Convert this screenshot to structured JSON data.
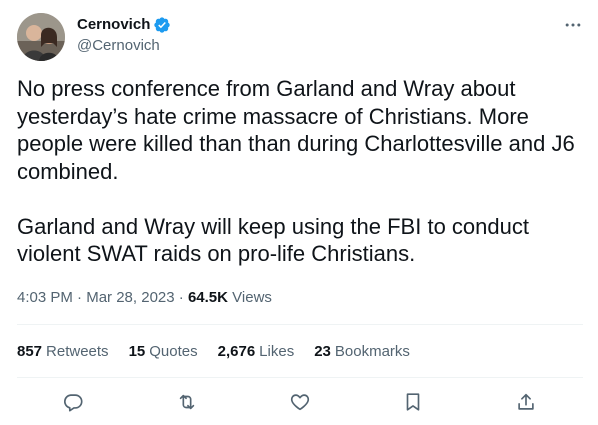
{
  "author": {
    "name": "Cernovich",
    "handle": "@Cernovich",
    "verified": true
  },
  "tweet": {
    "paragraphs": [
      "No press conference from Garland and Wray about yesterday’s hate crime massacre of Christians. More people were killed than than during Charlottesville and J6 combined.",
      "Garland and Wray will keep using the FBI to conduct violent SWAT raids on pro-life Christians."
    ],
    "time": "4:03 PM",
    "separator1": " · ",
    "date": "Mar 28, 2023",
    "separator2": " · ",
    "views_count": "64.5K",
    "views_label": "Views"
  },
  "stats": {
    "retweets": {
      "count": "857",
      "label": "Retweets"
    },
    "quotes": {
      "count": "15",
      "label": "Quotes"
    },
    "likes": {
      "count": "2,676",
      "label": "Likes"
    },
    "bookmarks": {
      "count": "23",
      "label": "Bookmarks"
    }
  },
  "actions": [
    "reply-icon",
    "retweet-icon",
    "like-icon",
    "bookmark-icon",
    "share-icon"
  ],
  "colors": {
    "text": "#0f1419",
    "secondary": "#536471",
    "verified": "#1d9bf0",
    "divider": "#eff3f4"
  }
}
